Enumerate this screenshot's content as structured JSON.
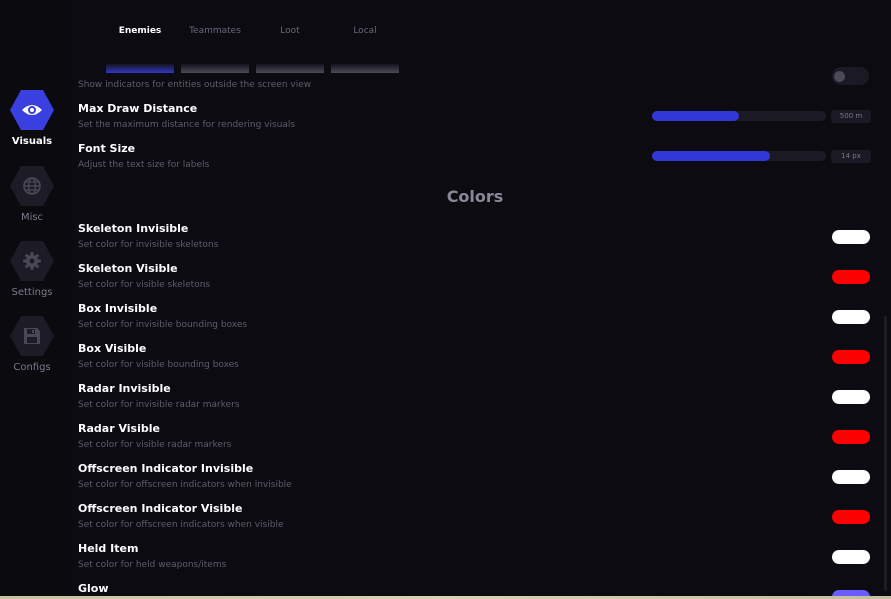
{
  "sidebar": {
    "items": [
      {
        "label": "Visuals",
        "icon": "eye-icon",
        "active": true
      },
      {
        "label": "Misc",
        "icon": "globe-icon",
        "active": false
      },
      {
        "label": "Settings",
        "icon": "gear-icon",
        "active": false
      },
      {
        "label": "Configs",
        "icon": "floppy-disk-icon",
        "active": false
      }
    ]
  },
  "tabs": [
    {
      "label": "Enemies",
      "active": true
    },
    {
      "label": "Teammates",
      "active": false
    },
    {
      "label": "Loot",
      "active": false
    },
    {
      "label": "Local",
      "active": false
    }
  ],
  "settings": {
    "offscreen": {
      "desc": "Show indicators for entities outside the screen view",
      "toggle_on": false
    },
    "max_draw_distance": {
      "title": "Max Draw Distance",
      "desc": "Set the maximum distance for rendering visuals",
      "value_label": "500 m",
      "fill_fraction": 0.5
    },
    "font_size": {
      "title": "Font Size",
      "desc": "Adjust the text size for labels",
      "value_label": "14 px",
      "fill_fraction": 0.68
    }
  },
  "colors_section": {
    "title": "Colors",
    "items": [
      {
        "title": "Skeleton Invisible",
        "desc": "Set color for invisible skeletons",
        "color": "#ffffff"
      },
      {
        "title": "Skeleton Visible",
        "desc": "Set color for visible skeletons",
        "color": "#ff0000"
      },
      {
        "title": "Box Invisible",
        "desc": "Set color for invisible bounding boxes",
        "color": "#ffffff"
      },
      {
        "title": "Box Visible",
        "desc": "Set color for visible bounding boxes",
        "color": "#ff0000"
      },
      {
        "title": "Radar Invisible",
        "desc": "Set color for invisible radar markers",
        "color": "#ffffff"
      },
      {
        "title": "Radar Visible",
        "desc": "Set color for visible radar markers",
        "color": "#ff0000"
      },
      {
        "title": "Offscreen Indicator Invisible",
        "desc": "Set color for offscreen indicators when invisible",
        "color": "#ffffff"
      },
      {
        "title": "Offscreen Indicator Visible",
        "desc": "Set color for offscreen indicators when visible",
        "color": "#ff0000"
      },
      {
        "title": "Held Item",
        "desc": "Set color for held weapons/items",
        "color": "#ffffff"
      },
      {
        "title": "Glow",
        "desc": "",
        "color": "#6a5cff"
      }
    ]
  },
  "theme": {
    "accent": "#3a3fe0",
    "background": "#0c0b12"
  }
}
